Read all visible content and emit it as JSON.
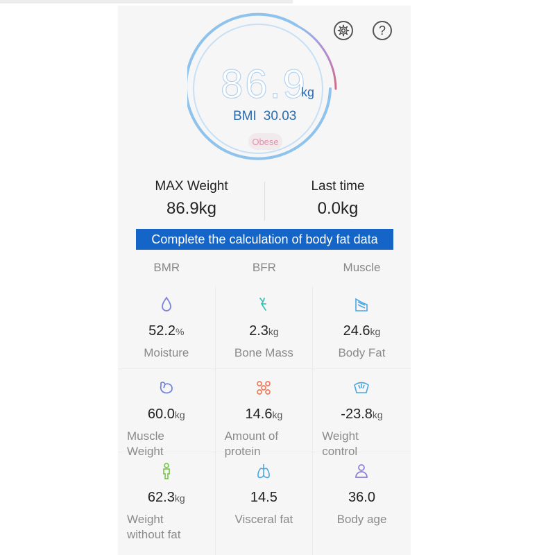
{
  "header": {
    "weight": "86.9",
    "weight_unit": "kg",
    "bmi_label": "BMI",
    "bmi_value": "30.03",
    "status": "Obese",
    "gauge_fraction": 0.86
  },
  "summary": {
    "max_weight_label": "MAX Weight",
    "max_weight_value": "86.9kg",
    "last_time_label": "Last time",
    "last_time_value": "0.0kg"
  },
  "banner_text": "Complete the calculation of body fat data",
  "metric_headers": [
    "BMR",
    "BFR",
    "Muscle"
  ],
  "metrics": [
    {
      "icon": "water-drop-icon",
      "value": "52.2",
      "unit": "%",
      "name": "Moisture"
    },
    {
      "icon": "bone-icon",
      "value": "2.3",
      "unit": "kg",
      "name": "Bone Mass"
    },
    {
      "icon": "body-fat-icon",
      "value": "24.6",
      "unit": "kg",
      "name": "Body Fat"
    },
    {
      "icon": "muscle-arm-icon",
      "value": "60.0",
      "unit": "kg",
      "name": "Muscle Weight"
    },
    {
      "icon": "protein-molecule-icon",
      "value": "14.6",
      "unit": "kg",
      "name": "Amount of protein"
    },
    {
      "icon": "scale-icon",
      "value": "-23.8",
      "unit": "kg",
      "name": "Weight control"
    },
    {
      "icon": "person-icon",
      "value": "62.3",
      "unit": "kg",
      "name": "Weight without fat"
    },
    {
      "icon": "lungs-icon",
      "value": "14.5",
      "unit": "",
      "name": "Visceral fat"
    },
    {
      "icon": "user-age-icon",
      "value": "36.0",
      "unit": "",
      "name": "Body age"
    }
  ],
  "colors": {
    "accent": "#1565c8",
    "gauge": "#8ec3ee",
    "gauge_end": "#d06a86",
    "obese": "#e490a8"
  }
}
